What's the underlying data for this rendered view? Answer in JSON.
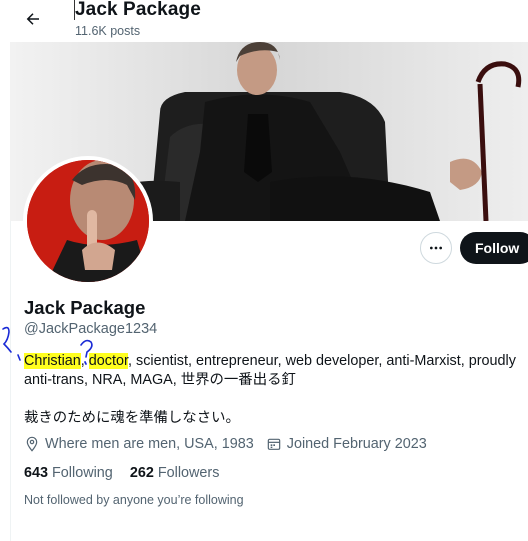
{
  "header": {
    "title": "Jack Package",
    "post_count": "11.6K posts",
    "back_icon": "arrow-left-icon"
  },
  "profile": {
    "name": "Jack Package",
    "handle": "@JackPackage1234",
    "bio": {
      "highlight_1": "Christian",
      "sep_1": ", ",
      "highlight_2": "doctor",
      "rest": ", scientist, entrepreneur, web developer, anti-Marxist, proudly anti-trans, NRA, MAGA, 世界の一番出る釘"
    },
    "bio_line_2": "裁きのために魂を準備しなさい。",
    "location": "Where men are men, USA, 1983",
    "joined": "Joined February 2023",
    "following_count": "643",
    "following_label": "Following",
    "followers_count": "262",
    "followers_label": "Followers",
    "not_followed_text": "Not followed by anyone you’re following"
  },
  "actions": {
    "more_icon": "more-dots-icon",
    "follow_label": "Follow"
  },
  "colors": {
    "text": "#0f1419",
    "secondary_text": "#536471",
    "highlight": "#ffff1f",
    "annotation_ink": "#1a2bd6",
    "follow_button_bg": "#0f1419",
    "avatar_bg": "#c81d12"
  }
}
